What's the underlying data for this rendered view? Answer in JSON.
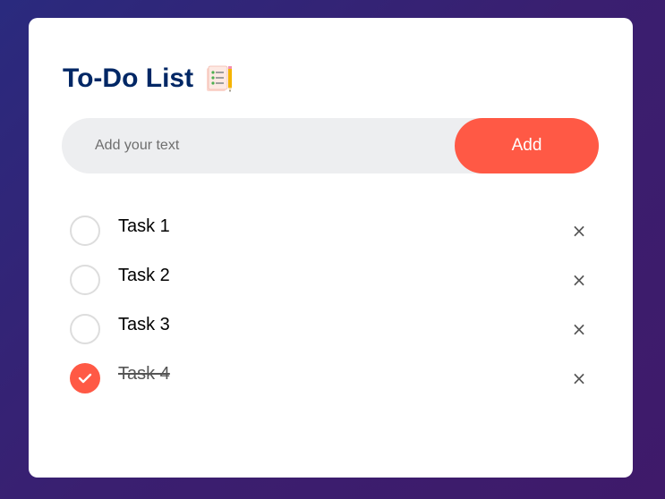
{
  "app": {
    "title": "To-Do List",
    "title_icon": "notepad-pencil-icon"
  },
  "input": {
    "placeholder": "Add your text",
    "value": ""
  },
  "add_button": {
    "label": "Add"
  },
  "tasks": [
    {
      "text": "Task 1",
      "checked": false
    },
    {
      "text": "Task 2",
      "checked": false
    },
    {
      "text": "Task 3",
      "checked": false
    },
    {
      "text": "Task 4",
      "checked": true
    }
  ],
  "delete_symbol": "×",
  "colors": {
    "accent": "#ff5945",
    "title": "#002765",
    "input_bg": "#edeef0",
    "background_start": "#2a2a7e",
    "background_end": "#3f1a6a"
  }
}
